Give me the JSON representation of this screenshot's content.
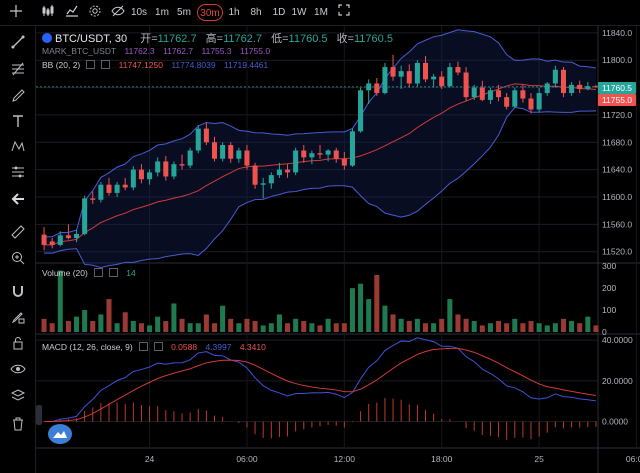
{
  "toolbar": {
    "intervals": [
      "10s",
      "1m",
      "5m",
      "30m",
      "1h",
      "8h",
      "1D",
      "1W",
      "1M"
    ],
    "active_interval": "30m",
    "icons": [
      "crosshair-icon",
      "candles-icon",
      "indicators-icon",
      "settings-icon",
      "visibility-icon",
      "fullscreen-icon"
    ]
  },
  "left_tools": [
    "trend-line-icon",
    "fib-icon",
    "brush-icon",
    "text-icon",
    "pattern-icon",
    "measure-icon",
    "arrow-left-icon",
    "ruler-icon",
    "zoom-icon",
    "magnet-icon",
    "lock-pencil-icon",
    "lock-icon",
    "eye-icon",
    "layers-icon",
    "trash-icon"
  ],
  "header": {
    "symbol": "BTC/USDT, 30",
    "open_label": "开=",
    "open": "11762.7",
    "high_label": "高=",
    "high": "11762.7",
    "low_label": "低=",
    "low": "11760.5",
    "close_label": "收=",
    "close": "11760.5"
  },
  "mark": {
    "label": "MARK_BTC_USDT",
    "v1": "11762.3",
    "v2": "11762.7",
    "v3": "11755.3",
    "v4": "11755.0"
  },
  "bb": {
    "label": "BB (20, 2)",
    "basis": "11747.1250",
    "upper": "11774.8039",
    "lower": "11719.4461"
  },
  "volume_legend": {
    "label": "Volume (20)",
    "value": "14"
  },
  "macd_legend": {
    "label": "MACD (12, 26, close, 9)",
    "hist": "0.0588",
    "macd": "4.3997",
    "signal": "4.3410"
  },
  "price_tags": {
    "last": "11760.5",
    "mark": "11755.0"
  },
  "colors": {
    "up": "#26a69a",
    "down": "#ef5350",
    "bb_upper": "#4a5bd4",
    "bb_lower": "#4a5bd4",
    "bb_basis": "#d23a3a",
    "macd": "#3f51d8",
    "signal": "#d23a3a",
    "bg": "#000000"
  },
  "chart_data": [
    {
      "type": "candlestick",
      "title": "BTC/USDT, 30",
      "y_ticks": [
        "11840.0",
        "11800.0",
        "11760.0",
        "11720.0",
        "11680.0",
        "11640.0",
        "11600.0",
        "11560.0",
        "11520.0"
      ],
      "ylim": [
        11505,
        11850
      ],
      "x_ticks": [
        "24",
        "06:00",
        "12:00",
        "18:00",
        "25",
        "06:00"
      ],
      "x_tick_index": [
        13,
        25,
        37,
        49,
        61,
        73
      ],
      "candles": [
        [
          11545,
          11556,
          11522,
          11530
        ],
        [
          11535,
          11540,
          11525,
          11530
        ],
        [
          11530,
          11550,
          11528,
          11544
        ],
        [
          11544,
          11560,
          11538,
          11540
        ],
        [
          11540,
          11552,
          11534,
          11546
        ],
        [
          11546,
          11602,
          11544,
          11598
        ],
        [
          11598,
          11608,
          11590,
          11596
        ],
        [
          11596,
          11622,
          11592,
          11618
        ],
        [
          11618,
          11628,
          11602,
          11606
        ],
        [
          11606,
          11622,
          11600,
          11618
        ],
        [
          11618,
          11628,
          11610,
          11614
        ],
        [
          11614,
          11645,
          11610,
          11640
        ],
        [
          11640,
          11648,
          11620,
          11626
        ],
        [
          11626,
          11640,
          11618,
          11636
        ],
        [
          11636,
          11658,
          11630,
          11652
        ],
        [
          11652,
          11660,
          11624,
          11630
        ],
        [
          11630,
          11652,
          11626,
          11648
        ],
        [
          11648,
          11662,
          11640,
          11646
        ],
        [
          11646,
          11672,
          11642,
          11668
        ],
        [
          11668,
          11705,
          11664,
          11700
        ],
        [
          11700,
          11708,
          11676,
          11680
        ],
        [
          11680,
          11688,
          11652,
          11656
        ],
        [
          11656,
          11680,
          11652,
          11676
        ],
        [
          11676,
          11680,
          11650,
          11656
        ],
        [
          11656,
          11672,
          11650,
          11668
        ],
        [
          11668,
          11676,
          11640,
          11646
        ],
        [
          11646,
          11650,
          11612,
          11618
        ],
        [
          11618,
          11628,
          11598,
          11620
        ],
        [
          11620,
          11636,
          11612,
          11632
        ],
        [
          11632,
          11650,
          11628,
          11640
        ],
        [
          11640,
          11648,
          11628,
          11636
        ],
        [
          11636,
          11672,
          11632,
          11668
        ],
        [
          11668,
          11676,
          11650,
          11658
        ],
        [
          11658,
          11668,
          11648,
          11664
        ],
        [
          11664,
          11676,
          11656,
          11662
        ],
        [
          11662,
          11670,
          11652,
          11668
        ],
        [
          11668,
          11672,
          11650,
          11656
        ],
        [
          11656,
          11666,
          11640,
          11646
        ],
        [
          11646,
          11700,
          11644,
          11696
        ],
        [
          11696,
          11760,
          11694,
          11756
        ],
        [
          11756,
          11772,
          11736,
          11766
        ],
        [
          11766,
          11774,
          11748,
          11752
        ],
        [
          11752,
          11796,
          11750,
          11790
        ],
        [
          11790,
          11808,
          11770,
          11776
        ],
        [
          11776,
          11792,
          11758,
          11784
        ],
        [
          11784,
          11794,
          11760,
          11766
        ],
        [
          11766,
          11800,
          11762,
          11796
        ],
        [
          11796,
          11806,
          11768,
          11772
        ],
        [
          11772,
          11780,
          11760,
          11776
        ],
        [
          11776,
          11784,
          11758,
          11762
        ],
        [
          11762,
          11796,
          11760,
          11790
        ],
        [
          11790,
          11798,
          11778,
          11782
        ],
        [
          11782,
          11790,
          11740,
          11746
        ],
        [
          11746,
          11764,
          11742,
          11760
        ],
        [
          11760,
          11770,
          11740,
          11742
        ],
        [
          11742,
          11760,
          11736,
          11756
        ],
        [
          11756,
          11764,
          11740,
          11746
        ],
        [
          11746,
          11752,
          11728,
          11732
        ],
        [
          11732,
          11760,
          11730,
          11756
        ],
        [
          11756,
          11764,
          11738,
          11744
        ],
        [
          11744,
          11752,
          11722,
          11728
        ],
        [
          11728,
          11760,
          11724,
          11752
        ],
        [
          11752,
          11768,
          11748,
          11766
        ],
        [
          11766,
          11792,
          11760,
          11786
        ],
        [
          11786,
          11790,
          11746,
          11752
        ],
        [
          11752,
          11768,
          11748,
          11764
        ],
        [
          11764,
          11770,
          11752,
          11758
        ],
        [
          11758,
          11768,
          11756,
          11762
        ],
        [
          11762,
          11764,
          11760,
          11761
        ]
      ]
    },
    {
      "type": "bar",
      "title": "Volume (20)",
      "y_ticks": [
        "300",
        "200",
        "100",
        "0"
      ],
      "ylim": [
        0,
        310
      ],
      "values": [
        60,
        40,
        280,
        50,
        70,
        100,
        50,
        80,
        150,
        40,
        90,
        50,
        40,
        30,
        70,
        50,
        130,
        60,
        40,
        40,
        80,
        40,
        120,
        60,
        40,
        60,
        50,
        30,
        40,
        80,
        40,
        60,
        50,
        40,
        30,
        60,
        40,
        40,
        200,
        220,
        150,
        260,
        120,
        80,
        60,
        50,
        60,
        40,
        40,
        60,
        150,
        80,
        60,
        50,
        30,
        40,
        50,
        40,
        60,
        40,
        50,
        40,
        30,
        40,
        60,
        50,
        40,
        70,
        30,
        20
      ]
    },
    {
      "type": "line",
      "title": "MACD (12, 26, close, 9)",
      "y_ticks": [
        "40.0000",
        "20.0000",
        "0.0000"
      ],
      "ylim": [
        -12,
        42
      ]
    }
  ]
}
